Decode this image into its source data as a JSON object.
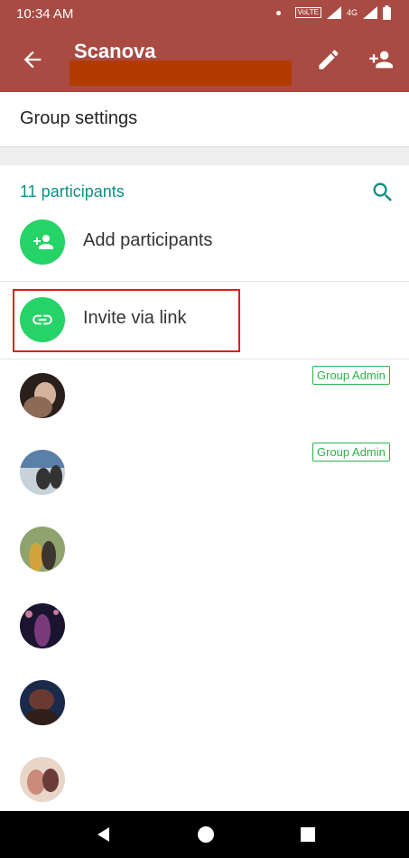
{
  "status_bar": {
    "time": "10:34 AM",
    "network": "4G"
  },
  "app_bar": {
    "title": "Scanova"
  },
  "group_settings_label": "Group settings",
  "participants_count_label": "11 participants",
  "actions": [
    {
      "label": "Add participants",
      "icon": "add-person-icon"
    },
    {
      "label": "Invite via link",
      "icon": "link-icon"
    }
  ],
  "members": [
    {
      "badge": "Group Admin",
      "avatar_colors": [
        "#2a1f1c",
        "#8c6a55",
        "#d5b39a"
      ]
    },
    {
      "badge": "Group Admin",
      "avatar_colors": [
        "#5a7fa8",
        "#c8d2da",
        "#333333"
      ]
    },
    {
      "badge": "",
      "avatar_colors": [
        "#8fa36f",
        "#d1a33b",
        "#3c3530"
      ]
    },
    {
      "badge": "",
      "avatar_colors": [
        "#1a1430",
        "#7a3a7a",
        "#c77a9a"
      ]
    },
    {
      "badge": "",
      "avatar_colors": [
        "#1a2a4a",
        "#6a3a30",
        "#2e1f1a"
      ]
    },
    {
      "badge": "",
      "avatar_colors": [
        "#c98a7a",
        "#6b3a3a",
        "#e8d6c8"
      ]
    }
  ],
  "colors": {
    "primary": "#a94b43",
    "accent_green": "#25d366",
    "teal": "#0f8f86",
    "highlight_red": "#e21b1b"
  }
}
